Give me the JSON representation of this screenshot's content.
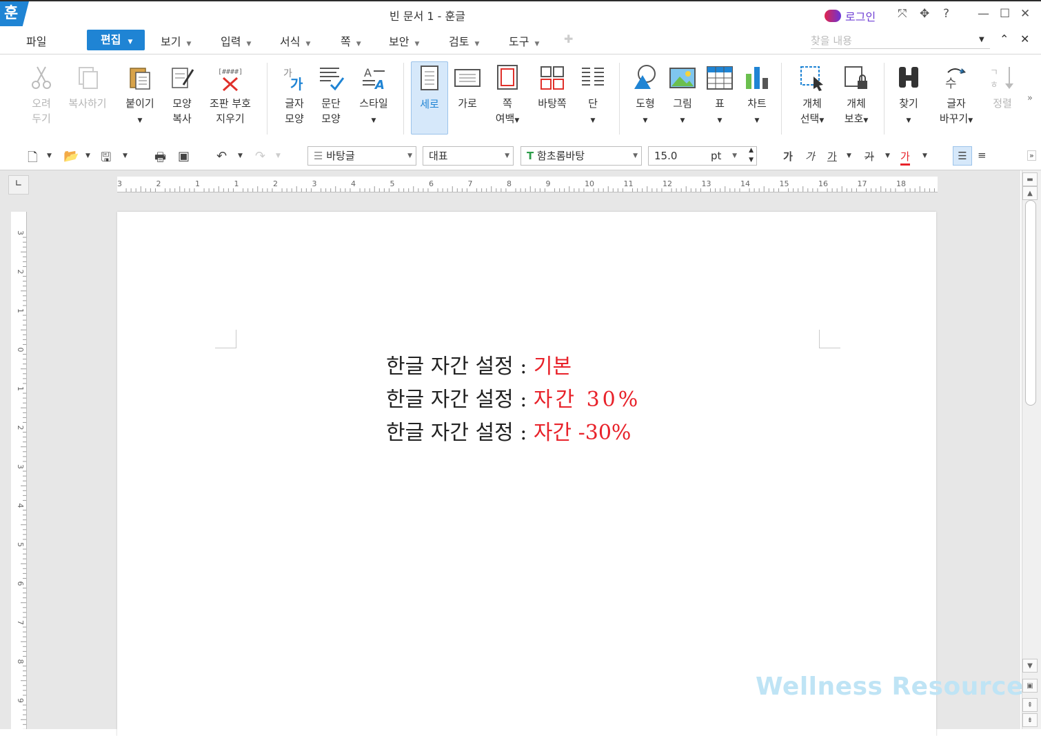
{
  "window": {
    "title": "빈 문서 1 - 훈글",
    "logo": "훈",
    "login": "로그인",
    "help": "?"
  },
  "menu": {
    "file": "파일",
    "active": "편집",
    "items": [
      "보기",
      "입력",
      "서식",
      "쪽",
      "보안",
      "검토",
      "도구"
    ],
    "search_placeholder": "찾을 내용"
  },
  "ribbon": {
    "cut": [
      "오려",
      "두기"
    ],
    "copy": "복사하기",
    "paste": "붙이기",
    "format_copy": [
      "모양",
      "복사"
    ],
    "clear_code": [
      "조판 부호",
      "지우기"
    ],
    "char_shape": [
      "글자",
      "모양"
    ],
    "para_shape": [
      "문단",
      "모양"
    ],
    "style": "스타일",
    "portrait": "세로",
    "landscape": "가로",
    "margin": [
      "쪽",
      "여백"
    ],
    "master_page": "바탕쪽",
    "columns": "단",
    "shape": "도형",
    "picture": "그림",
    "table": "표",
    "chart": "차트",
    "obj_select": [
      "개체",
      "선택"
    ],
    "obj_protect": [
      "개체",
      "보호"
    ],
    "find": "찾기",
    "replace": [
      "글자",
      "바꾸기"
    ],
    "sort": "정렬"
  },
  "format_bar": {
    "style": "바탕글",
    "lang": "대표",
    "font": "함초롬바탕",
    "size": "15.0",
    "unit": "pt",
    "bold": "가",
    "italic": "가",
    "underline": "가",
    "strike": "가",
    "color": "가"
  },
  "ruler": {
    "h_ticks": [
      "3",
      "2",
      "1",
      "1",
      "2",
      "3",
      "4",
      "5",
      "6",
      "7",
      "8",
      "9",
      "10",
      "11",
      "12",
      "13",
      "14",
      "15",
      "16",
      "17",
      "18"
    ],
    "v_ticks": [
      "3",
      "2",
      "1",
      "0",
      "1",
      "2",
      "3",
      "4",
      "5",
      "6",
      "7",
      "8",
      "9"
    ]
  },
  "document": {
    "lines": [
      {
        "label": "한글 자간 설정 : ",
        "value": "기본"
      },
      {
        "label": "한글 자간 설정 : ",
        "value": "자간 30%"
      },
      {
        "label": "한글 자간 설정 : ",
        "value": "자간 -30%"
      }
    ]
  },
  "watermark": "Wellness Resources",
  "colors": {
    "accent": "#1f84d4",
    "value_red": "#e8222a",
    "login": "#6f3fd4"
  }
}
